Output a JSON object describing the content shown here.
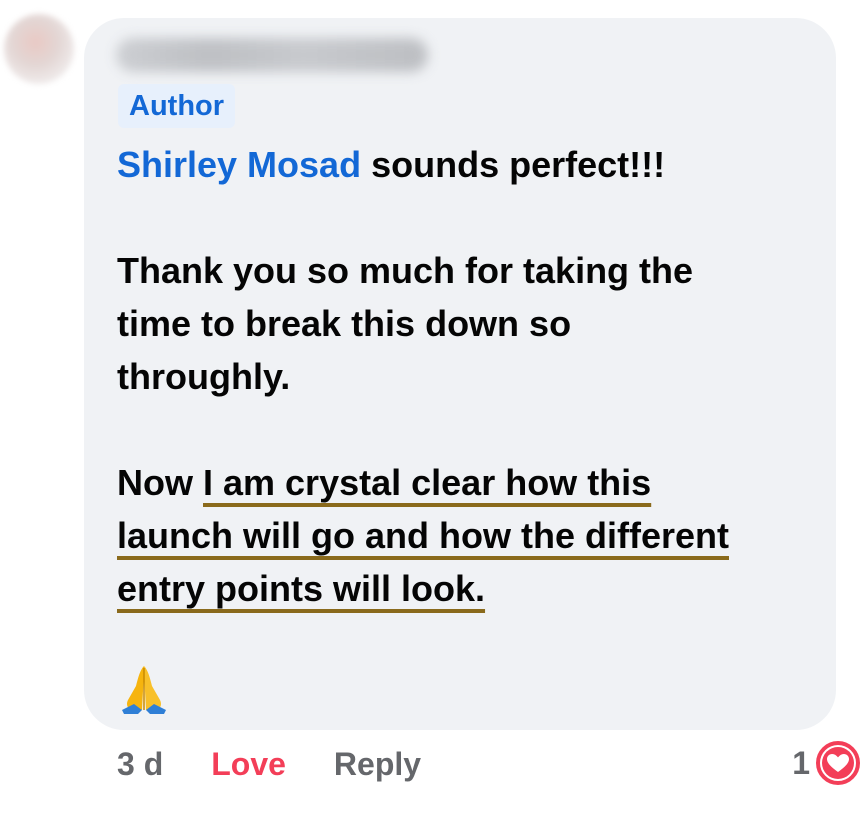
{
  "comment": {
    "badge": "Author",
    "mention": "Shirley Mosad",
    "line1_rest": " sounds perfect!!!",
    "para2": [
      "Thank you so much for taking the",
      "time to break this down so",
      "throughly."
    ],
    "para3": {
      "line1_plain": "Now ",
      "line1_underlined": "I am crystal clear how this",
      "line2": "launch will go and how the different",
      "line3": "entry points will look."
    },
    "emoji": "folded-hands"
  },
  "actions": {
    "time": "3 d",
    "love": "Love",
    "reply": "Reply"
  },
  "reactions": {
    "count": "1",
    "icon": "heart-icon",
    "color": "#f33e58"
  },
  "colors": {
    "bubble": "#f0f2f5",
    "accent_blue": "#1368d6",
    "underline": "#8a6a1c",
    "muted": "#65676b",
    "love": "#f33e58"
  }
}
